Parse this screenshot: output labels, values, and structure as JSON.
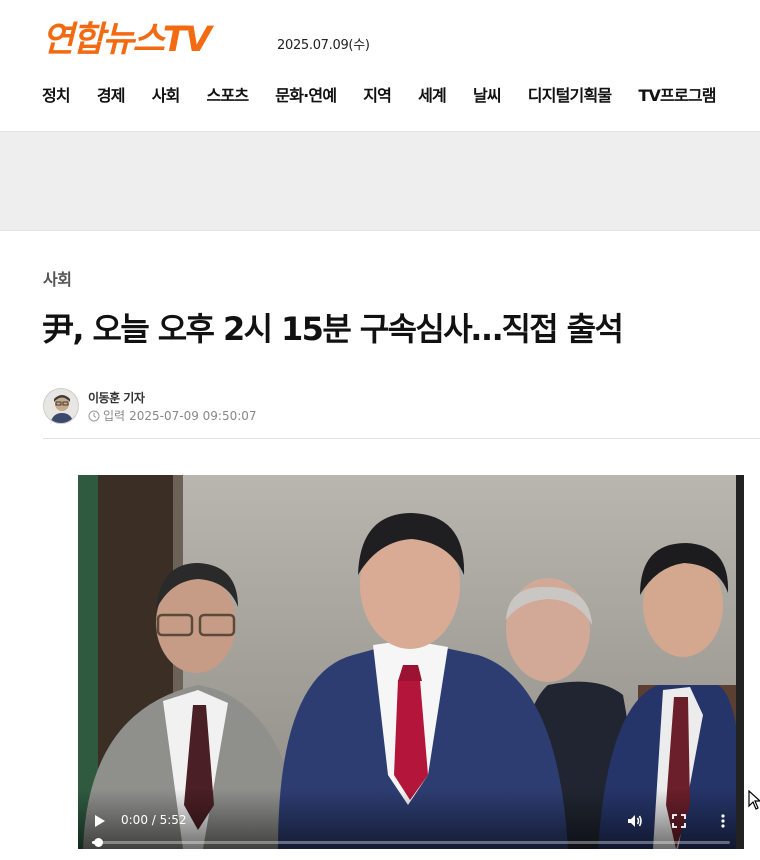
{
  "site": {
    "logo": "연합뉴스TV",
    "date": "2025.07.09(수)",
    "brand_color": "#f26b13"
  },
  "nav": {
    "items": [
      "정치",
      "경제",
      "사회",
      "스포츠",
      "문화·연예",
      "지역",
      "세계",
      "날씨",
      "디지털기획물",
      "TV프로그램"
    ]
  },
  "article": {
    "category": "사회",
    "headline": "尹, 오늘 오후 2시 15분 구속심사…직접 출석",
    "reporter": "이동훈 기자",
    "published_label": "입력",
    "published_at": "2025-07-09 09:50:07"
  },
  "video": {
    "time_display": "0:00 / 5:52",
    "progress": 0.01,
    "icons": [
      "play-icon",
      "volume-icon",
      "fullscreen-icon",
      "more-options-icon"
    ]
  }
}
